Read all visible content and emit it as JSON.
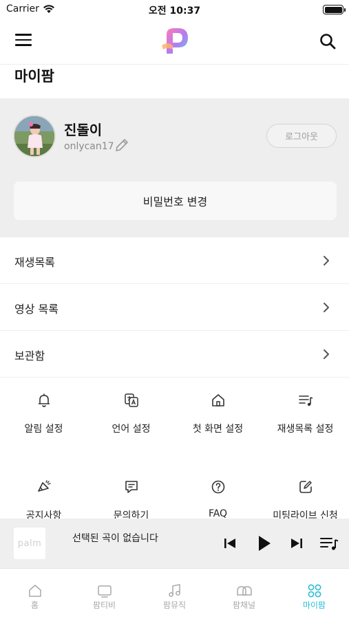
{
  "status_bar": {
    "carrier": "Carrier",
    "time": "오전 10:37"
  },
  "header": {
    "menu_icon": "hamburger-icon",
    "logo_icon": "palm-logo",
    "search_icon": "search-icon",
    "page_title": "마이팜"
  },
  "profile": {
    "name": "진돌이",
    "user_id": "onlycan17",
    "edit_icon": "pencil-icon",
    "logout_label": "로그아웃",
    "change_password_label": "비밀번호 변경"
  },
  "menu": {
    "items": [
      {
        "label": "재생목록"
      },
      {
        "label": "영상 목록"
      },
      {
        "label": "보관함"
      }
    ]
  },
  "settings": {
    "items": [
      {
        "label": "알림 설정",
        "icon": "bell-icon"
      },
      {
        "label": "언어 설정",
        "icon": "translate-icon"
      },
      {
        "label": "첫 화면 설정",
        "icon": "home-icon"
      },
      {
        "label": "재생목록 설정",
        "icon": "playlist-icon"
      },
      {
        "label": "공지사항",
        "icon": "megaphone-icon"
      },
      {
        "label": "문의하기",
        "icon": "chat-icon"
      },
      {
        "label": "FAQ",
        "icon": "question-icon"
      },
      {
        "label": "미팅라이브 신청",
        "icon": "edit-icon"
      }
    ]
  },
  "player": {
    "thumbnail_text": "palm",
    "now_playing": "선택된 곡이 없습니다"
  },
  "tabs": {
    "items": [
      {
        "label": "홈",
        "icon": "home-icon"
      },
      {
        "label": "팜티비",
        "icon": "tv-icon"
      },
      {
        "label": "팜뮤직",
        "icon": "music-icon"
      },
      {
        "label": "팜채널",
        "icon": "channel-icon"
      },
      {
        "label": "마이팜",
        "icon": "grid-icon"
      }
    ],
    "active_index": 4,
    "active_color": "#27bdd2"
  }
}
